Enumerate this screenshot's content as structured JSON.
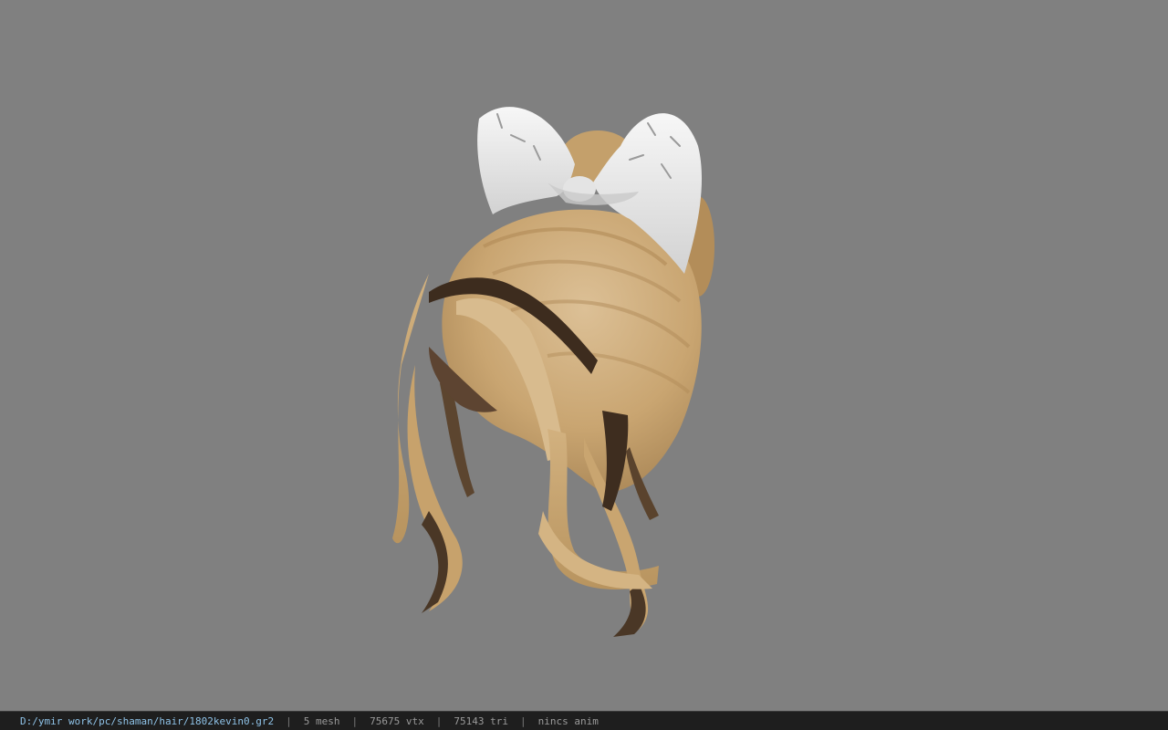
{
  "viewer": {
    "background_color": "#808080",
    "model": {
      "icon": "hair-model-icon",
      "hair_color": "#cfae7e",
      "bow_color": "#ededed"
    }
  },
  "status_bar": {
    "file_path": "D:/ymir work/pc/shaman/hair/1802kevin0.gr2",
    "separator": "|",
    "mesh": "5 mesh",
    "vtx": "75675 vtx",
    "tri": "75143 tri",
    "anim": "nincs anim"
  }
}
